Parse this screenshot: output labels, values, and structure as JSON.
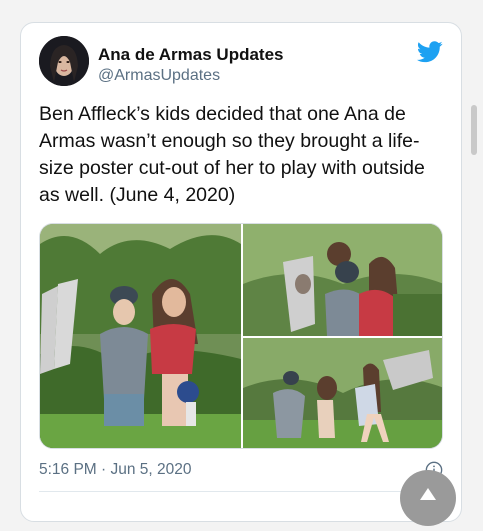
{
  "tweet": {
    "display_name": "Ana de Armas Updates",
    "handle": "@ArmasUpdates",
    "text": "Ben Affleck’s kids decided that one Ana de Armas wasn’t enough so they brought a life-size poster cut-out of her to play with outside as well. (June 4, 2020)",
    "timestamp": "5:16 PM · Jun 5, 2020",
    "brand_icon": "twitter-bird-icon",
    "info_icon": "info-icon"
  },
  "media": {
    "photos": [
      {
        "name": "photo-1"
      },
      {
        "name": "photo-2"
      },
      {
        "name": "photo-3"
      }
    ]
  },
  "colors": {
    "twitter_blue": "#1da1f2",
    "text_primary": "#111111",
    "text_secondary": "#5b7083",
    "border": "#d8dee3"
  }
}
